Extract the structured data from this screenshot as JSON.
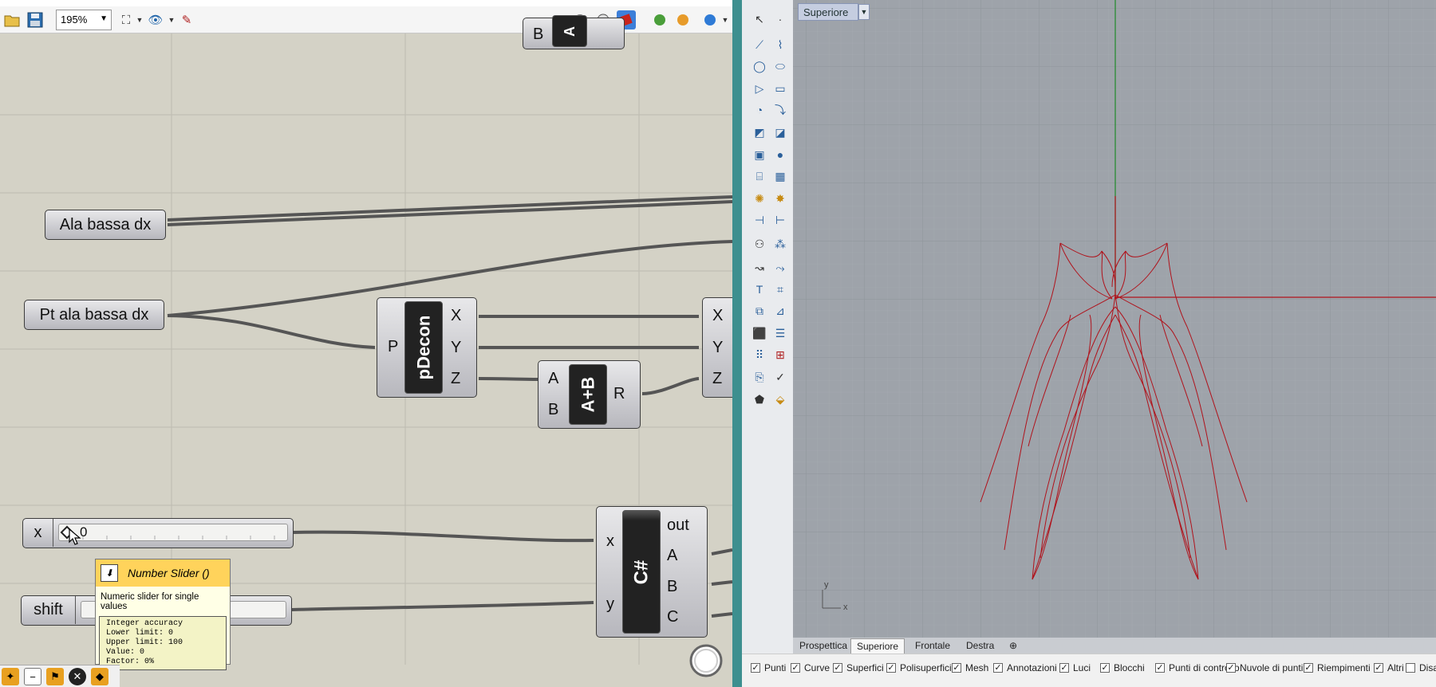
{
  "toolbar": {
    "zoom": "195%"
  },
  "canvas": {
    "params": {
      "ala_bassa_dx": "Ala bassa dx",
      "pt_ala_bassa_dx": "Pt ala bassa dx"
    },
    "pdecon": {
      "name": "pDecon",
      "input": "P",
      "outputs": [
        "X",
        "Y",
        "Z"
      ]
    },
    "addition": {
      "name": "A+B",
      "inputs": [
        "A",
        "B"
      ],
      "output": "R"
    },
    "partial_top": {
      "name": "A",
      "input": "B"
    },
    "construct": {
      "inputs": [
        "X",
        "Y",
        "Z"
      ]
    },
    "slider_x": {
      "label": "x",
      "value": "0"
    },
    "slider_shift": {
      "label": "shift"
    },
    "csharp": {
      "name": "C#",
      "inputs": [
        "x",
        "y"
      ],
      "outputs": [
        "out",
        "A",
        "B",
        "C"
      ]
    }
  },
  "tooltip": {
    "title": "Number Slider ()",
    "description": "Numeric slider for single values",
    "details": "Integer accuracy\nLower limit: 0\nUpper limit: 100\nValue: 0\nFactor: 0%"
  },
  "viewport": {
    "title": "Superiore",
    "axis_x": "x",
    "axis_y": "y"
  },
  "viewport_tabs": [
    "Prospettica",
    "Superiore",
    "Frontale",
    "Destra"
  ],
  "osnap": [
    {
      "label": "Punti",
      "checked": true
    },
    {
      "label": "Curve",
      "checked": true
    },
    {
      "label": "Superfici",
      "checked": true
    },
    {
      "label": "Polisuperfici",
      "checked": true
    },
    {
      "label": "Mesh",
      "checked": true
    },
    {
      "label": "Annotazioni",
      "checked": true
    },
    {
      "label": "Luci",
      "checked": true
    },
    {
      "label": "Blocchi",
      "checked": true
    },
    {
      "label": "Punti di controllo",
      "checked": true
    },
    {
      "label": "Nuvole di punti",
      "checked": true
    },
    {
      "label": "Riempimenti",
      "checked": true
    },
    {
      "label": "Altri",
      "checked": true
    },
    {
      "label": "Disa",
      "checked": false
    }
  ],
  "colors": {
    "canvas": "#d4d2c6",
    "viewport": "#9ea3aa",
    "curve": "#b0121b",
    "tooltip_header": "#ffd35b",
    "splitter": "#3d8f8f"
  },
  "icons": [
    "open-file-icon",
    "save-icon",
    "zoom-extents-icon",
    "preview-eye-icon",
    "sketch-icon",
    "shaded-icon",
    "wireframe-icon",
    "bake-icon",
    "select-arrow-icon",
    "point-icon",
    "polyline-icon",
    "circle-icon",
    "box-icon",
    "text-icon",
    "settings-icon"
  ]
}
